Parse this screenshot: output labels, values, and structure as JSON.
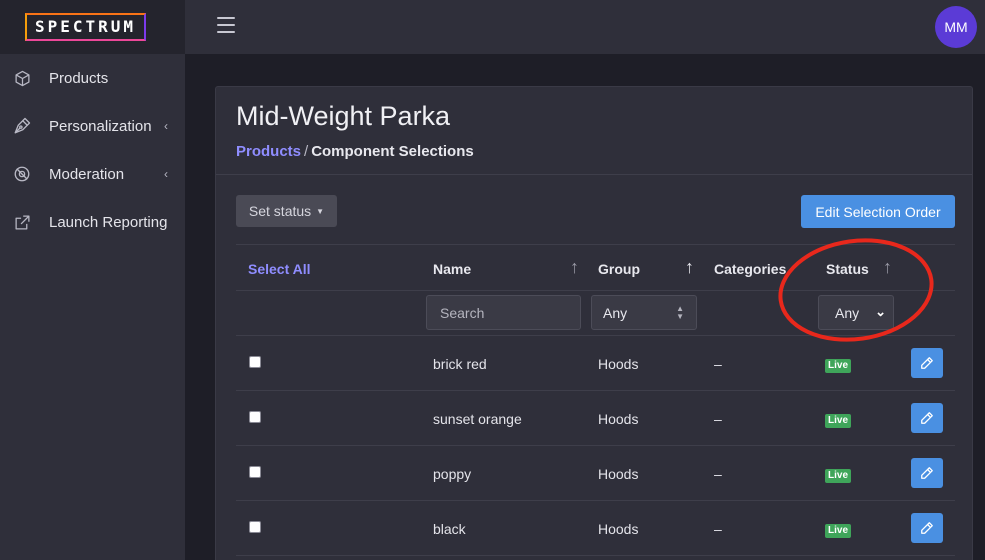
{
  "brand": {
    "logo_text": "SPECTRUM"
  },
  "sidebar": {
    "items": [
      {
        "label": "Products",
        "icon": "cube-icon",
        "has_submenu": false
      },
      {
        "label": "Personalization",
        "icon": "pen-nib-icon",
        "has_submenu": true
      },
      {
        "label": "Moderation",
        "icon": "moderation-icon",
        "has_submenu": true
      },
      {
        "label": "Launch Reporting",
        "icon": "external-link-icon",
        "has_submenu": false
      }
    ]
  },
  "topbar": {
    "menu_icon": "hamburger-icon",
    "avatar_initials": "MM"
  },
  "page": {
    "title": "Mid-Weight Parka",
    "breadcrumb": {
      "link": "Products",
      "separator": "/",
      "current": "Component Selections"
    }
  },
  "toolbar": {
    "set_status_label": "Set status",
    "edit_order_label": "Edit Selection Order"
  },
  "table": {
    "headers": {
      "select_all": "Select All",
      "name": "Name",
      "group": "Group",
      "categories": "Categories",
      "status": "Status"
    },
    "filters": {
      "search_placeholder": "Search",
      "group_value": "Any",
      "status_value": "Any"
    },
    "rows": [
      {
        "name": "brick red",
        "group": "Hoods",
        "categories": "–",
        "status": "Live"
      },
      {
        "name": "sunset orange",
        "group": "Hoods",
        "categories": "–",
        "status": "Live"
      },
      {
        "name": "poppy",
        "group": "Hoods",
        "categories": "–",
        "status": "Live"
      },
      {
        "name": "black",
        "group": "Hoods",
        "categories": "–",
        "status": "Live"
      }
    ]
  },
  "colors": {
    "accent_link": "#8f8dff",
    "primary_button": "#4a90e2",
    "live_badge": "#3fa55a",
    "avatar": "#5b3bd6",
    "annotation": "#e8281c"
  }
}
